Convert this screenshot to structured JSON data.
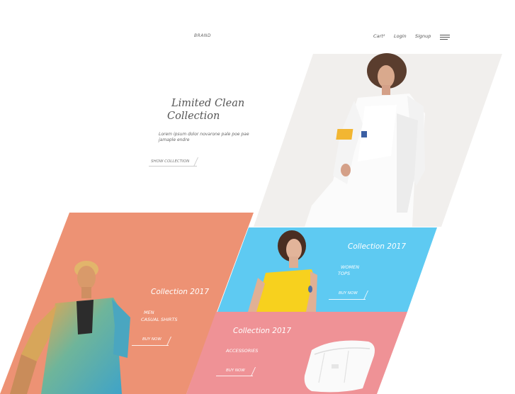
{
  "header": {
    "brand": "BRAND",
    "nav": {
      "cart": "Cart²",
      "login": "Login",
      "signup": "Signup"
    },
    "menu_icon": "hamburger-menu-icon"
  },
  "hero": {
    "title_line1": "Limited Clean",
    "title_line2": "Collection",
    "description": "Lorem ipsum dolor novarone pale poe pae jamaple endre",
    "cta": "SHOW COLLECTION",
    "background": "#f1efed"
  },
  "promos": [
    {
      "title": "Collection 2017",
      "category_line1": "MEN",
      "category_line2": "CASUAL SHIRTS",
      "cta": "BUY NOW",
      "color": "#ed9274"
    },
    {
      "title": "Collection 2017",
      "category_line1": "WOMEN",
      "category_line2": "TOPS",
      "cta": "BUY NOW",
      "color": "#5ecaf2"
    },
    {
      "title": "Collection 2017",
      "category_line1": "ACCESSORIES",
      "cta": "BUY NOW",
      "color": "#ef9296"
    }
  ]
}
